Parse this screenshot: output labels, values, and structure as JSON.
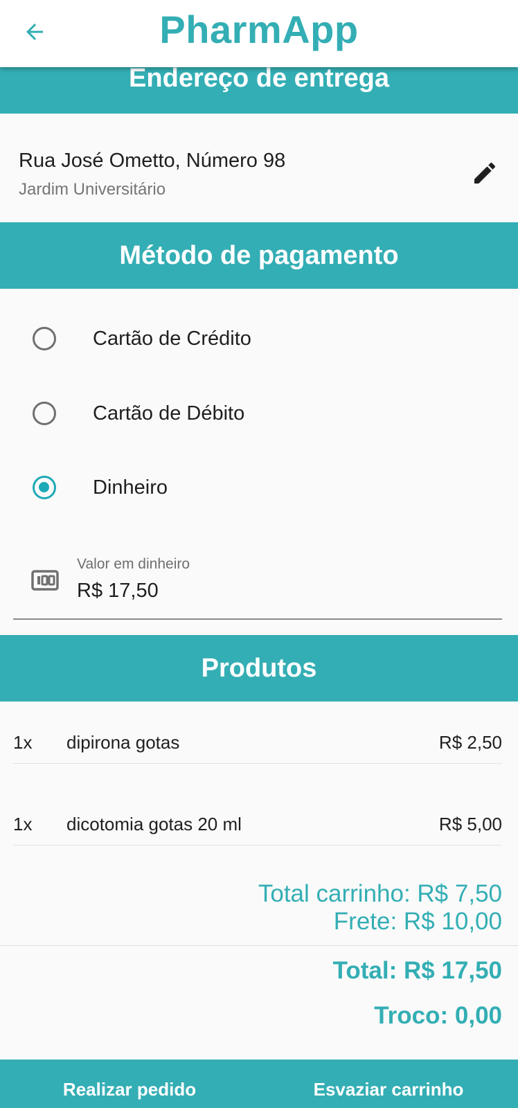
{
  "app": {
    "title": "PharmApp"
  },
  "address": {
    "header": "Endereço de entrega",
    "street": "Rua José Ometto, Número 98",
    "district": "Jardim Universitário"
  },
  "payment": {
    "header": "Método de pagamento",
    "options": [
      {
        "label": "Cartão de Crédito",
        "selected": false
      },
      {
        "label": "Cartão de Débito",
        "selected": false
      },
      {
        "label": "Dinheiro",
        "selected": true
      }
    ],
    "cash_field": {
      "label": "Valor em dinheiro",
      "value": "R$ 17,50"
    }
  },
  "products": {
    "header": "Produtos",
    "items": [
      {
        "qty": "1x",
        "name": "dipirona gotas",
        "price": "R$ 2,50"
      },
      {
        "qty": "1x",
        "name": "dicotomia gotas 20 ml",
        "price": "R$ 5,00"
      }
    ]
  },
  "summary": {
    "cart_total": "Total carrinho: R$ 7,50",
    "freight": "Frete: R$ 10,00",
    "total": "Total: R$ 17,50",
    "change": "Troco: 0,00"
  },
  "actions": {
    "place_order": "Realizar pedido",
    "clear_cart": "Esvaziar carrinho"
  },
  "colors": {
    "accent": "#33aeb4",
    "radio_selected": "#1ea9b7"
  }
}
